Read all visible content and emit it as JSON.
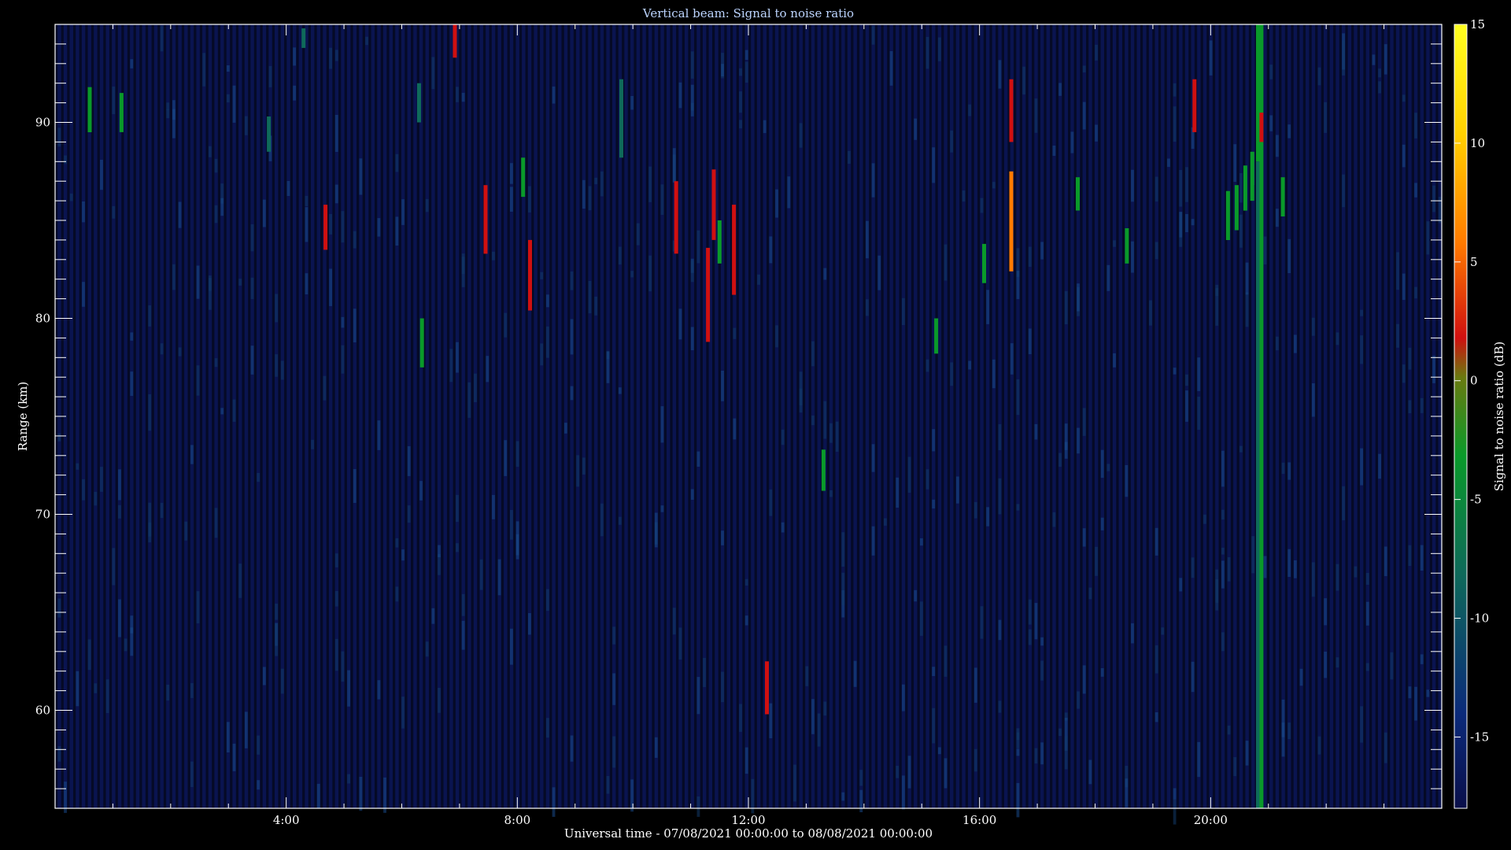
{
  "chart_data": {
    "type": "heatmap",
    "title": "Vertical beam: Signal to noise ratio",
    "xlabel": "Universal time - 07/08/2021 00:00:00 to 08/08/2021 00:00:00",
    "ylabel": "Range (km)",
    "colorbar_label": "Signal to noise ratio (dB)",
    "xlim_hours": [
      0,
      24
    ],
    "ylim_km": [
      55,
      95
    ],
    "x_ticks": [
      {
        "value": 4,
        "label": "4:00"
      },
      {
        "value": 8,
        "label": "8:00"
      },
      {
        "value": 12,
        "label": "12:00"
      },
      {
        "value": 16,
        "label": "16:00"
      },
      {
        "value": 20,
        "label": "20:00"
      }
    ],
    "y_ticks": [
      {
        "value": 60,
        "label": "60"
      },
      {
        "value": 70,
        "label": "70"
      },
      {
        "value": 80,
        "label": "80"
      },
      {
        "value": 90,
        "label": "90"
      }
    ],
    "colorbar_range_db": [
      -18,
      15
    ],
    "colorbar_ticks": [
      {
        "value": 15,
        "label": "15"
      },
      {
        "value": 10,
        "label": "10"
      },
      {
        "value": 5,
        "label": "5"
      },
      {
        "value": 0,
        "label": "0"
      },
      {
        "value": -5,
        "label": "-5"
      },
      {
        "value": -10,
        "label": "-10"
      },
      {
        "value": -15,
        "label": "-15"
      }
    ],
    "colormap": [
      "#0a0f4a",
      "#0b2a7a",
      "#0f6a5a",
      "#0a9a2a",
      "#6a7a10",
      "#d01010",
      "#ff7a00",
      "#ffd000",
      "#ffff20"
    ],
    "background_level_db": -16,
    "echoes": [
      {
        "t": 0.6,
        "r0": 89.5,
        "r1": 91.8,
        "snr": -4
      },
      {
        "t": 1.15,
        "r0": 89.5,
        "r1": 91.5,
        "snr": -2
      },
      {
        "t": 3.7,
        "r0": 88.5,
        "r1": 90.3,
        "snr": -6
      },
      {
        "t": 4.3,
        "r0": 93.8,
        "r1": 94.8,
        "snr": -6
      },
      {
        "t": 4.68,
        "r0": 83.5,
        "r1": 85.8,
        "snr": 2
      },
      {
        "t": 6.3,
        "r0": 90.0,
        "r1": 92.0,
        "snr": -6
      },
      {
        "t": 6.35,
        "r0": 77.5,
        "r1": 80.0,
        "snr": -5
      },
      {
        "t": 6.92,
        "r0": 93.3,
        "r1": 95.0,
        "snr": 3
      },
      {
        "t": 7.45,
        "r0": 83.3,
        "r1": 86.8,
        "snr": 2
      },
      {
        "t": 8.1,
        "r0": 86.2,
        "r1": 88.2,
        "snr": -5
      },
      {
        "t": 8.22,
        "r0": 80.4,
        "r1": 84.0,
        "snr": 3
      },
      {
        "t": 9.8,
        "r0": 88.2,
        "r1": 92.2,
        "snr": -6
      },
      {
        "t": 10.75,
        "r0": 83.3,
        "r1": 87.0,
        "snr": 2
      },
      {
        "t": 11.3,
        "r0": 78.8,
        "r1": 83.6,
        "snr": 2
      },
      {
        "t": 11.4,
        "r0": 84.0,
        "r1": 87.6,
        "snr": 2
      },
      {
        "t": 11.5,
        "r0": 82.8,
        "r1": 85.0,
        "snr": -4
      },
      {
        "t": 11.75,
        "r0": 81.2,
        "r1": 85.8,
        "snr": 3
      },
      {
        "t": 12.32,
        "r0": 59.8,
        "r1": 62.5,
        "snr": 3
      },
      {
        "t": 13.3,
        "r0": 71.2,
        "r1": 73.3,
        "snr": -5
      },
      {
        "t": 15.25,
        "r0": 78.2,
        "r1": 80.0,
        "snr": -5
      },
      {
        "t": 16.08,
        "r0": 81.8,
        "r1": 83.8,
        "snr": -5
      },
      {
        "t": 16.55,
        "r0": 89.0,
        "r1": 92.2,
        "snr": 3
      },
      {
        "t": 16.55,
        "r0": 82.4,
        "r1": 87.5,
        "snr": 6
      },
      {
        "t": 17.7,
        "r0": 85.5,
        "r1": 87.2,
        "snr": -5
      },
      {
        "t": 18.55,
        "r0": 82.8,
        "r1": 84.6,
        "snr": -5
      },
      {
        "t": 19.72,
        "r0": 89.5,
        "r1": 92.2,
        "snr": 2
      },
      {
        "t": 20.3,
        "r0": 84.0,
        "r1": 86.5,
        "snr": -4
      },
      {
        "t": 20.45,
        "r0": 84.5,
        "r1": 86.8,
        "snr": -3
      },
      {
        "t": 20.6,
        "r0": 85.5,
        "r1": 87.8,
        "snr": -3
      },
      {
        "t": 20.72,
        "r0": 86.0,
        "r1": 88.5,
        "snr": -4
      },
      {
        "t": 20.82,
        "r0": 88.0,
        "r1": 95.0,
        "snr": -5
      },
      {
        "t": 20.82,
        "r0": 55.0,
        "r1": 88.0,
        "snr": -7
      },
      {
        "t": 20.88,
        "r0": 55.0,
        "r1": 95.0,
        "snr": -5
      },
      {
        "t": 20.88,
        "r0": 89.0,
        "r1": 90.5,
        "snr": 2
      },
      {
        "t": 21.25,
        "r0": 85.2,
        "r1": 87.2,
        "snr": -5
      }
    ]
  }
}
